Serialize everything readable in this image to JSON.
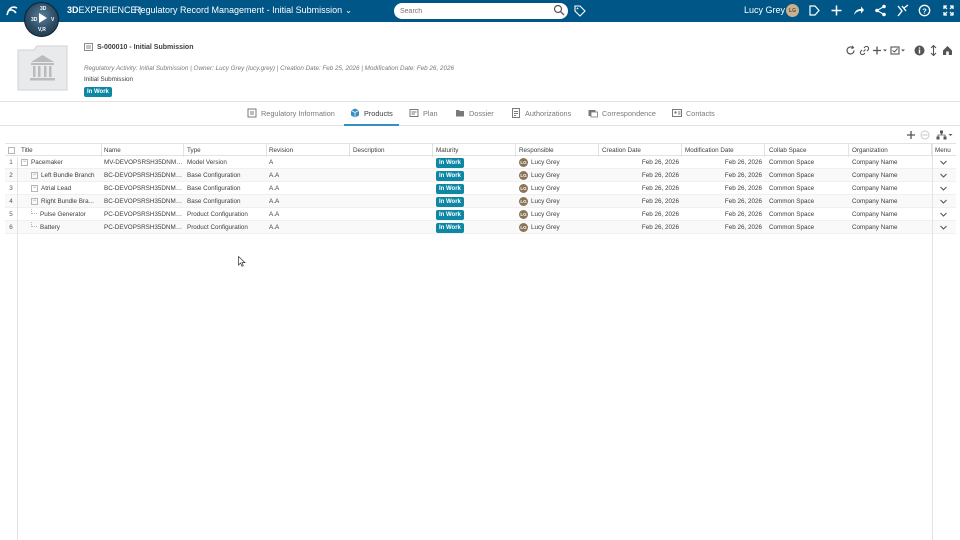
{
  "topbar": {
    "brand_bold": "3D",
    "brand_rest": "EXPERIENCE",
    "app_title": "Regulatory Record Management - Initial Submission",
    "search_placeholder": "Search",
    "user_name": "Lucy Grey",
    "user_initials": "LG",
    "compass_labels": {
      "top": "3D",
      "left": "3D",
      "right": "V",
      "bottom": "V,R"
    }
  },
  "header": {
    "object_title": "S-000010 - Initial Submission",
    "meta": "Regulatory Activity: Initial Submission  |  Owner: Lucy Grey (lucy.grey)  |  Creation Date: Feb 25, 2026  |  Modification Date: Feb 26, 2026",
    "subtitle": "Initial Submission",
    "status": "In Work"
  },
  "tabs": [
    {
      "label": "Regulatory Information",
      "icon": "document-icon"
    },
    {
      "label": "Products",
      "icon": "product-icon",
      "active": true
    },
    {
      "label": "Plan",
      "icon": "plan-icon"
    },
    {
      "label": "Dossier",
      "icon": "folder-icon"
    },
    {
      "label": "Authorizations",
      "icon": "authorization-icon"
    },
    {
      "label": "Correspondence",
      "icon": "correspondence-icon"
    },
    {
      "label": "Contacts",
      "icon": "contacts-icon"
    }
  ],
  "grid": {
    "columns": [
      "Title",
      "Name",
      "Type",
      "Revision",
      "Description",
      "Maturity",
      "Responsible",
      "Creation Date",
      "Modification Date",
      "Collab Space",
      "Organization",
      "Menu"
    ],
    "rows": [
      {
        "num": "1",
        "title": "Pacemaker",
        "name": "MV-DEVOPSRSH35DNM2...",
        "type": "Model Version",
        "revision": "A",
        "description": "",
        "maturity": "In Work",
        "resp_initials": "LG",
        "responsible": "Lucy Grey",
        "created": "Feb 26, 2026",
        "modified": "Feb 26, 2026",
        "space": "Common Space",
        "org": "Company Name"
      },
      {
        "num": "2",
        "title": "Left Bundle Branch",
        "name": "BC-DEVOPSRSH35DNM2...",
        "type": "Base Configuration",
        "revision": "A.A",
        "description": "",
        "maturity": "In Work",
        "resp_initials": "LG",
        "responsible": "Lucy Grey",
        "created": "Feb 26, 2026",
        "modified": "Feb 26, 2026",
        "space": "Common Space",
        "org": "Company Name"
      },
      {
        "num": "3",
        "title": "Atrial Lead",
        "name": "BC-DEVOPSRSH35DNM2...",
        "type": "Base Configuration",
        "revision": "A.A",
        "description": "",
        "maturity": "In Work",
        "resp_initials": "LG",
        "responsible": "Lucy Grey",
        "created": "Feb 26, 2026",
        "modified": "Feb 26, 2026",
        "space": "Common Space",
        "org": "Company Name"
      },
      {
        "num": "4",
        "title": "Right Bundle Bra...",
        "name": "BC-DEVOPSRSH35DNM2...",
        "type": "Base Configuration",
        "revision": "A.A",
        "description": "",
        "maturity": "In Work",
        "resp_initials": "LG",
        "responsible": "Lucy Grey",
        "created": "Feb 26, 2026",
        "modified": "Feb 26, 2026",
        "space": "Common Space",
        "org": "Company Name"
      },
      {
        "num": "5",
        "title": "Pulse Generator",
        "name": "PC-DEVOPSRSH35DNM2...",
        "type": "Product Configuration",
        "revision": "A.A",
        "description": "",
        "maturity": "In Work",
        "resp_initials": "LG",
        "responsible": "Lucy Grey",
        "created": "Feb 26, 2026",
        "modified": "Feb 26, 2026",
        "space": "Common Space",
        "org": "Company Name"
      },
      {
        "num": "6",
        "title": "Battery",
        "name": "PC-DEVOPSRSH35DNM2...",
        "type": "Product Configuration",
        "revision": "A.A",
        "description": "",
        "maturity": "In Work",
        "resp_initials": "LG",
        "responsible": "Lucy Grey",
        "created": "Feb 26, 2026",
        "modified": "Feb 26, 2026",
        "space": "Common Space",
        "org": "Company Name"
      }
    ]
  },
  "colors": {
    "topbar": "#005686",
    "badge": "#0d87a3",
    "tab_active": "#368ec4"
  }
}
